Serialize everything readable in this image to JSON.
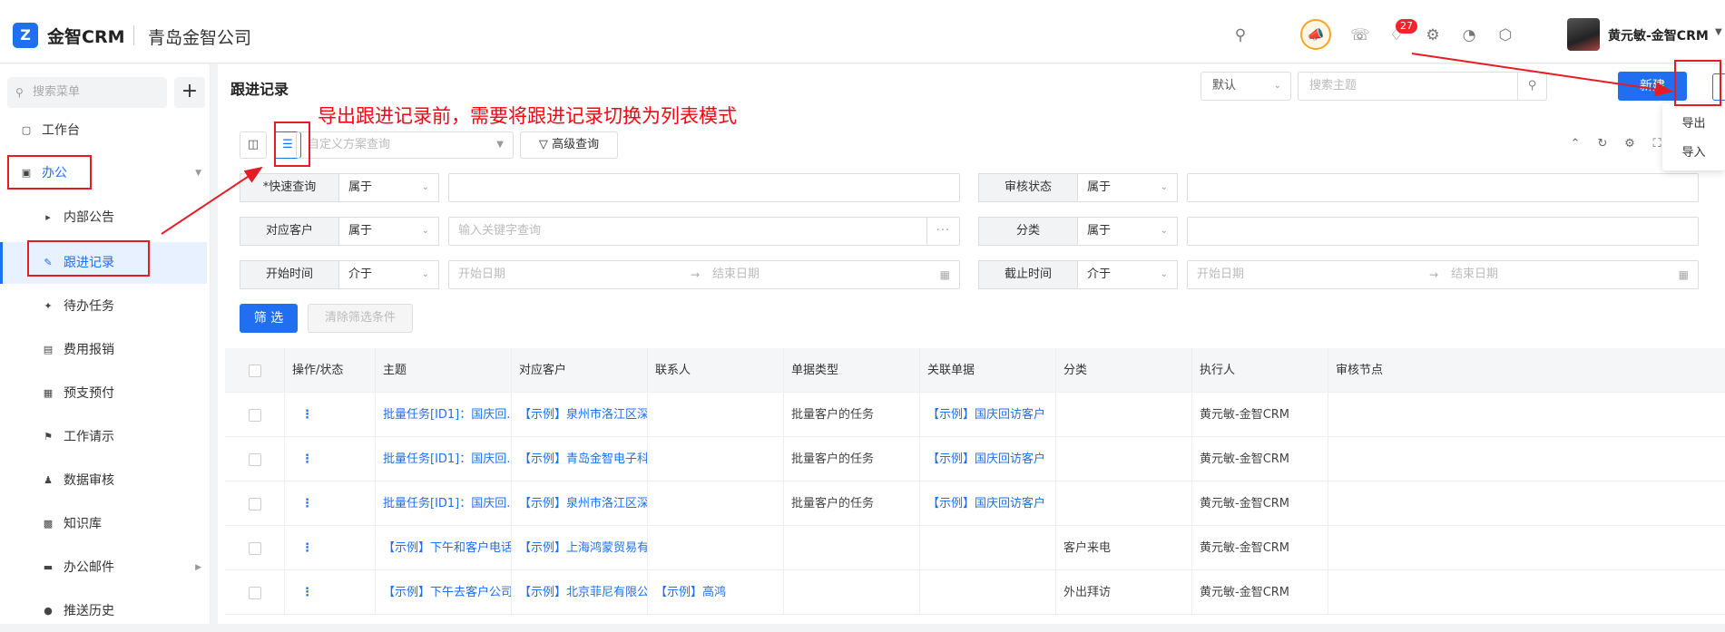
{
  "header": {
    "logo_text": "金智CRM",
    "company": "青岛金智公司",
    "notification_count": "27",
    "username": "黄元敏-金智CRM"
  },
  "sidebar": {
    "search_placeholder": "搜索菜单",
    "add_label": "+",
    "items": [
      {
        "label": "工作台"
      },
      {
        "label": "办公"
      },
      {
        "label": "内部公告"
      },
      {
        "label": "跟进记录"
      },
      {
        "label": "待办任务"
      },
      {
        "label": "费用报销"
      },
      {
        "label": "预支预付"
      },
      {
        "label": "工作请示"
      },
      {
        "label": "数据审核"
      },
      {
        "label": "知识库"
      },
      {
        "label": "办公邮件"
      },
      {
        "label": "推送历史"
      }
    ]
  },
  "main": {
    "title": "跟进记录",
    "default_view": "默认",
    "topic_search_placeholder": "搜索主题",
    "new_button": "新建",
    "more_menu": [
      "导出",
      "导入"
    ],
    "plan_placeholder": "自定义方案查询",
    "advanced_query": "高级查询"
  },
  "filters": {
    "quick_query": {
      "label": "*快速查询",
      "op": "属于"
    },
    "audit_status": {
      "label": "审核状态",
      "op": "属于"
    },
    "customer": {
      "label": "对应客户",
      "op": "属于",
      "placeholder": "输入关键字查询"
    },
    "category": {
      "label": "分类",
      "op": "属于"
    },
    "start_time": {
      "label": "开始时间",
      "op": "介于",
      "start": "开始日期",
      "end": "结束日期"
    },
    "end_time": {
      "label": "截止时间",
      "op": "介于",
      "start": "开始日期",
      "end": "结束日期"
    },
    "filter_button": "筛 选",
    "clear_button": "清除筛选条件"
  },
  "table": {
    "headers": [
      "操作/状态",
      "主题",
      "对应客户",
      "联系人",
      "单据类型",
      "关联单据",
      "分类",
      "执行人",
      "审核节点"
    ],
    "rows": [
      {
        "ops": "⋮",
        "topic": "批量任务[ID1]：国庆回...",
        "customer": "【示例】泉州市洛江区深...",
        "contact": "",
        "doc_type": "批量客户的任务",
        "related": "【示例】国庆回访客户",
        "category": "",
        "executor": "黄元敏-金智CRM",
        "node": ""
      },
      {
        "ops": "⋮",
        "topic": "批量任务[ID1]：国庆回...",
        "customer": "【示例】青岛金智电子科...",
        "contact": "",
        "doc_type": "批量客户的任务",
        "related": "【示例】国庆回访客户",
        "category": "",
        "executor": "黄元敏-金智CRM",
        "node": ""
      },
      {
        "ops": "⋮",
        "topic": "批量任务[ID1]：国庆回...",
        "customer": "【示例】泉州市洛江区深...",
        "contact": "",
        "doc_type": "批量客户的任务",
        "related": "【示例】国庆回访客户",
        "category": "",
        "executor": "黄元敏-金智CRM",
        "node": ""
      },
      {
        "ops": "⋮",
        "topic": "【示例】下午和客户电话...",
        "customer": "【示例】上海鸿蒙贸易有...",
        "contact": "",
        "doc_type": "",
        "related": "",
        "category": "客户来电",
        "executor": "黄元敏-金智CRM",
        "node": ""
      },
      {
        "ops": "⋮",
        "topic": "【示例】下午去客户公司...",
        "customer": "【示例】北京菲尼有限公...",
        "contact": "【示例】高鸿",
        "doc_type": "",
        "related": "",
        "category": "外出拜访",
        "executor": "黄元敏-金智CRM",
        "node": ""
      }
    ]
  },
  "annotation": {
    "note": "导出跟进记录前，需要将跟进记录切换为列表模式"
  },
  "colors": {
    "primary": "#1f6ff0",
    "annotation_red": "#e51c23",
    "badge_red": "#f5222d",
    "warning_orange": "#f5a623"
  }
}
